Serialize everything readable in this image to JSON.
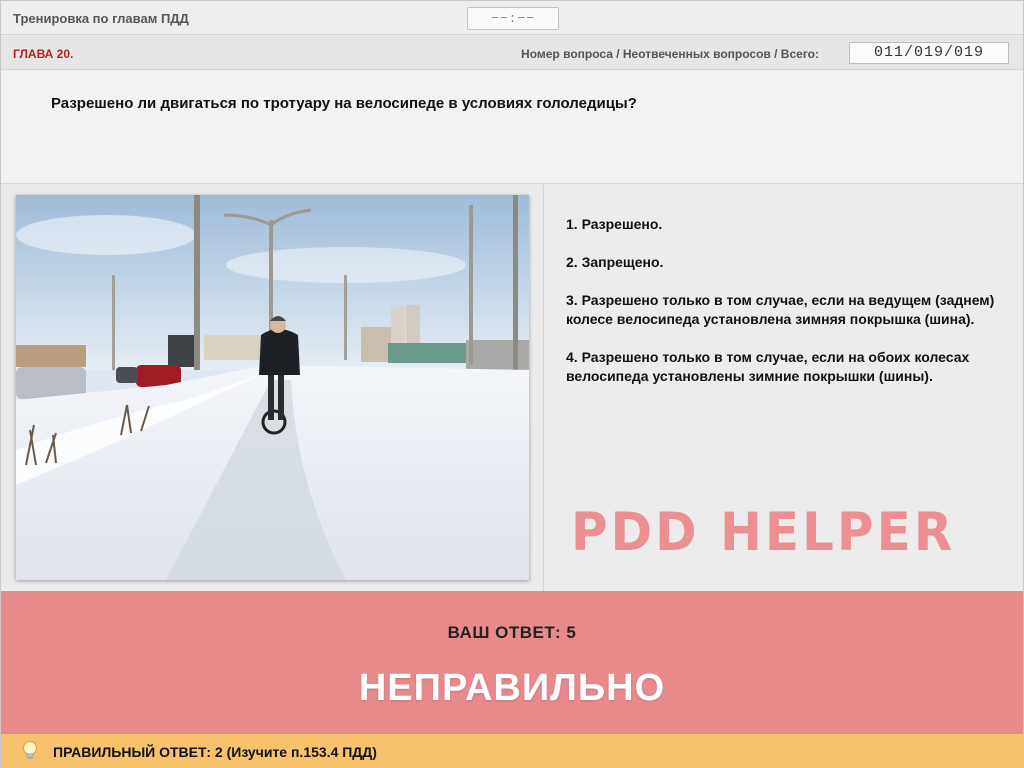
{
  "header": {
    "app_title": "Тренировка по главам ПДД",
    "timer": "−−:−−"
  },
  "chapter_bar": {
    "chapter": "ГЛАВА 20.",
    "counter_label": "Номер вопроса / Неотвеченных вопросов / Всего:",
    "counter_value": "011/019/019"
  },
  "question": {
    "text": "Разрешено ли двигаться по тротуару на велосипеде в условиях гололедицы?"
  },
  "answers": [
    "1.  Разрешено.",
    "2.  Запрещено.",
    "3.  Разрешено только в том случае, если на ведущем (заднем) колесе велосипеда установлена зимняя покрышка (шина).",
    "4.  Разрешено только в том случае, если на обоих колесах велосипеда установлены зимние покрышки (шины)."
  ],
  "watermark": "PDD HELPER",
  "result": {
    "your_answer": "ВАШ  ОТВЕТ:   5",
    "verdict": "НЕПРАВИЛЬНО"
  },
  "hint": {
    "icon": "lightbulb-icon",
    "text": "ПРАВИЛЬНЫЙ ОТВЕТ:   2   (Изучите п.153.4 ПДД)"
  },
  "colors": {
    "chapter": "#b22222",
    "result_bg": "#e8898c",
    "hint_bg": "#f8c16c",
    "watermark": "#ec8f93"
  }
}
